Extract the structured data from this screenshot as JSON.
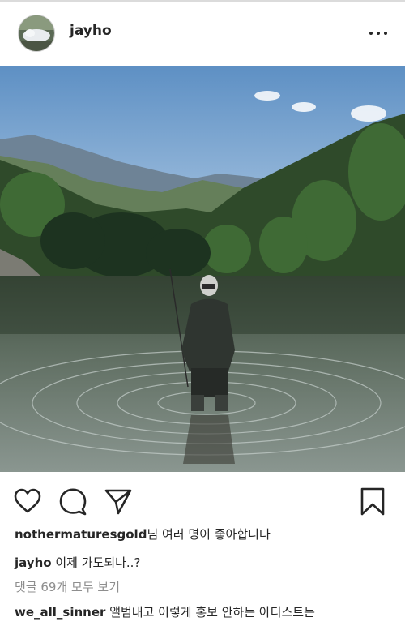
{
  "post": {
    "username": "jayho",
    "more_icon": "more-horizontal-icon",
    "image_alt": "Person standing in a mountain lake holding a fishing rod"
  },
  "actions": {
    "like_icon": "heart-outline-icon",
    "comment_icon": "comment-bubble-icon",
    "share_icon": "paper-plane-icon",
    "save_icon": "bookmark-outline-icon"
  },
  "likes": {
    "user": "nothermaturesgold",
    "suffix": "님 여러 명이 좋아합니다"
  },
  "caption": {
    "user": "jayho",
    "text": " 이제 가도되나..?"
  },
  "comments": {
    "view_all": "댓글 69개 모두 보기",
    "items": [
      {
        "user": "we_all_sinner",
        "text": " 앨범내고 이렇게 홍보 안하는 아티스트는"
      }
    ]
  },
  "colors": {
    "text": "#262626",
    "muted": "#8e8e8e",
    "divider": "#dbdbdb"
  }
}
